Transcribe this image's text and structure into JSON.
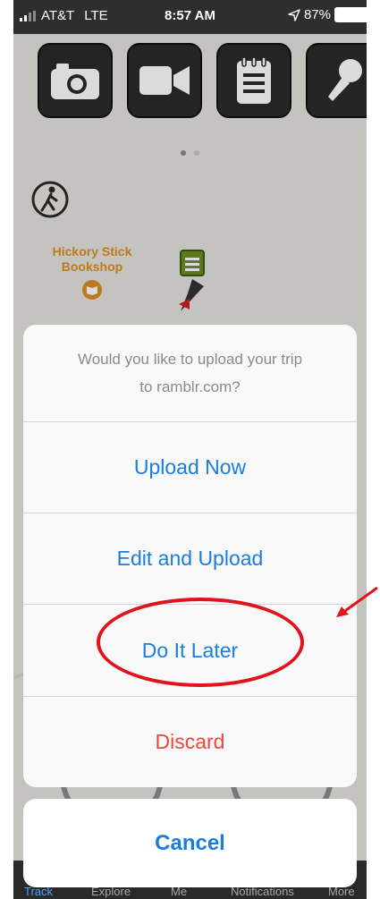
{
  "status_bar": {
    "carrier": "AT&T",
    "network": "LTE",
    "time": "8:57 AM",
    "battery": "87%"
  },
  "toolbar": {
    "buttons": [
      "camera-icon",
      "video-icon",
      "notes-icon",
      "microphone-icon"
    ],
    "page_count": 2,
    "active_page": 1
  },
  "map": {
    "poi_name": "Hickory Stick Bookshop"
  },
  "dialog": {
    "message": "Would you like to upload your trip to ramblr.com?",
    "actions": [
      {
        "label": "Upload Now",
        "style": "default"
      },
      {
        "label": "Edit and Upload",
        "style": "default"
      },
      {
        "label": "Do It Later",
        "style": "default"
      },
      {
        "label": "Discard",
        "style": "destructive"
      }
    ],
    "cancel_label": "Cancel"
  },
  "tab_bar": {
    "tabs": [
      "Track",
      "Explore",
      "Me",
      "Notifications",
      "More"
    ],
    "active": "Track"
  },
  "colors": {
    "accent": "#1a7ee0",
    "destructive": "#f2453a",
    "annotation": "#e0141c",
    "map_label": "#d98f23"
  }
}
